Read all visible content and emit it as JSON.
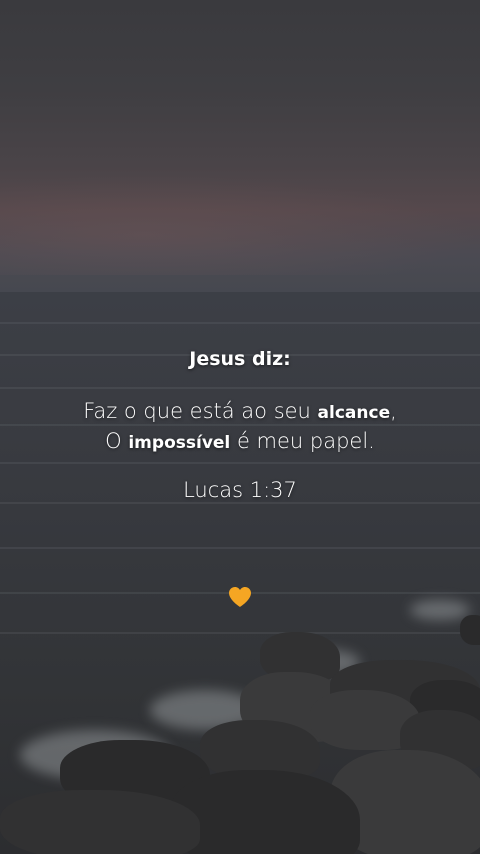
{
  "post": {
    "heading": "Jesus diz:",
    "quote_line1_part1": "Faz o que está ao seu ",
    "quote_line1_bold": "alcance",
    "quote_line1_part2": ",",
    "quote_line2_part1": "O ",
    "quote_line2_bold": "impossível",
    "quote_line2_part2": " é meu papel.",
    "reference": "Lucas 1:37",
    "heart_icon": "orange-heart-icon",
    "heart_color": "#f5a623"
  },
  "background": {
    "scene": "ocean-dusk-with-rocks"
  }
}
